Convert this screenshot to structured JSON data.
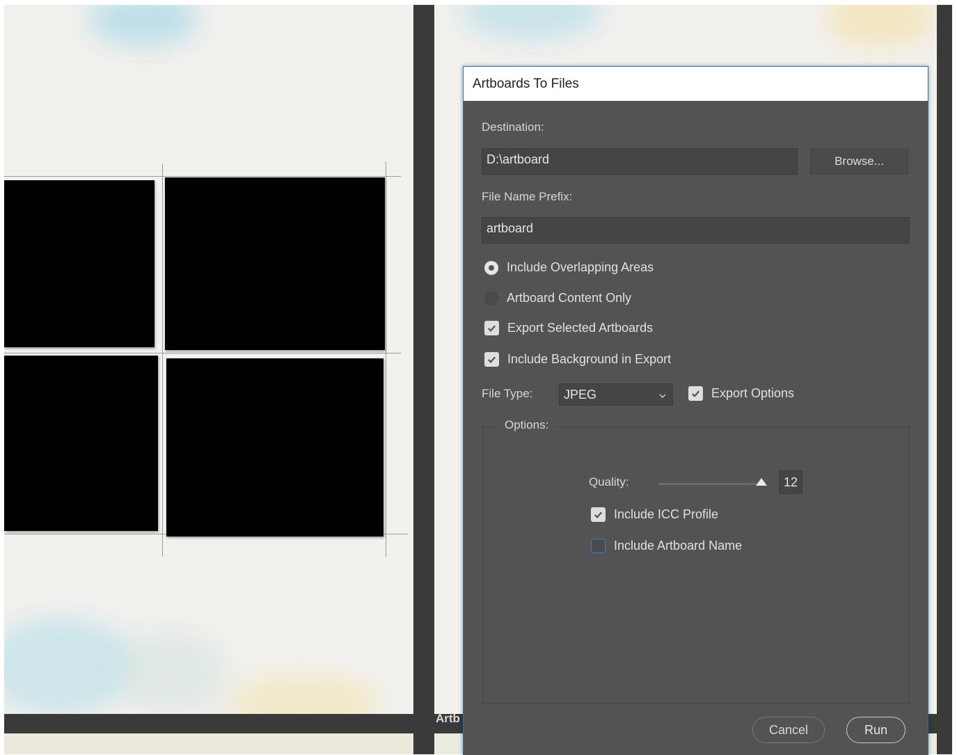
{
  "dialog": {
    "title": "Artboards To Files",
    "destination_label": "Destination:",
    "destination_value": "D:\\artboard",
    "browse_label": "Browse...",
    "prefix_label": "File Name Prefix:",
    "prefix_value": "artboard",
    "radio_overlapping": "Include Overlapping Areas",
    "radio_content_only": "Artboard Content Only",
    "check_export_selected": "Export Selected Artboards",
    "check_include_background": "Include Background in Export",
    "file_type_label": "File Type:",
    "file_type_value": "JPEG",
    "check_export_options": "Export Options",
    "options_group_label": "Options:",
    "quality_label": "Quality:",
    "quality_value": "12",
    "check_icc": "Include ICC Profile",
    "check_artboard_name": "Include Artboard Name",
    "cancel_label": "Cancel",
    "run_label": "Run",
    "state": {
      "overlapping_selected": true,
      "export_selected_checked": true,
      "include_background_checked": true,
      "export_options_checked": true,
      "icc_checked": true,
      "artboard_name_checked": false,
      "quality_level": 12
    }
  },
  "canvas": {
    "artboard_label_partial": "Artb"
  },
  "icons": {
    "chevron": "chevron-down-icon",
    "check": "checkmark-icon"
  }
}
